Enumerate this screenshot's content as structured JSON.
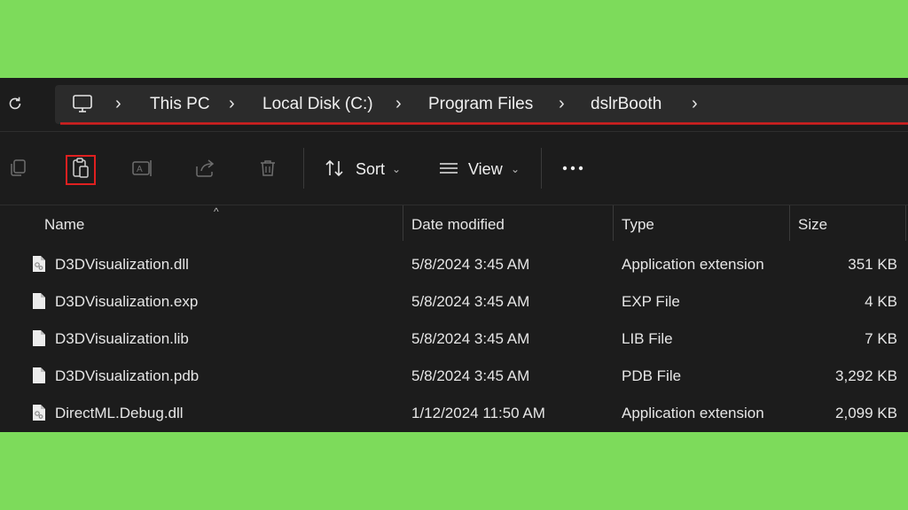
{
  "breadcrumb": {
    "items": [
      "This PC",
      "Local Disk (C:)",
      "Program Files",
      "dslrBooth"
    ]
  },
  "toolbar": {
    "sort_label": "Sort",
    "view_label": "View"
  },
  "columns": [
    "Name",
    "Date modified",
    "Type",
    "Size"
  ],
  "files": [
    {
      "name": "D3DVisualization.dll",
      "date": "5/8/2024 3:45 AM",
      "type": "Application extension",
      "size": "351 KB",
      "icon": "dll-file-icon"
    },
    {
      "name": "D3DVisualization.exp",
      "date": "5/8/2024 3:45 AM",
      "type": "EXP File",
      "size": "4 KB",
      "icon": "file-icon"
    },
    {
      "name": "D3DVisualization.lib",
      "date": "5/8/2024 3:45 AM",
      "type": "LIB File",
      "size": "7 KB",
      "icon": "file-icon"
    },
    {
      "name": "D3DVisualization.pdb",
      "date": "5/8/2024 3:45 AM",
      "type": "PDB File",
      "size": "3,292 KB",
      "icon": "file-icon"
    },
    {
      "name": "DirectML.Debug.dll",
      "date": "1/12/2024 11:50 AM",
      "type": "Application extension",
      "size": "2,099 KB",
      "icon": "dll-file-icon"
    }
  ],
  "colors": {
    "background": "#7ddb5b",
    "window": "#1c1c1c",
    "highlight": "#e02020"
  }
}
